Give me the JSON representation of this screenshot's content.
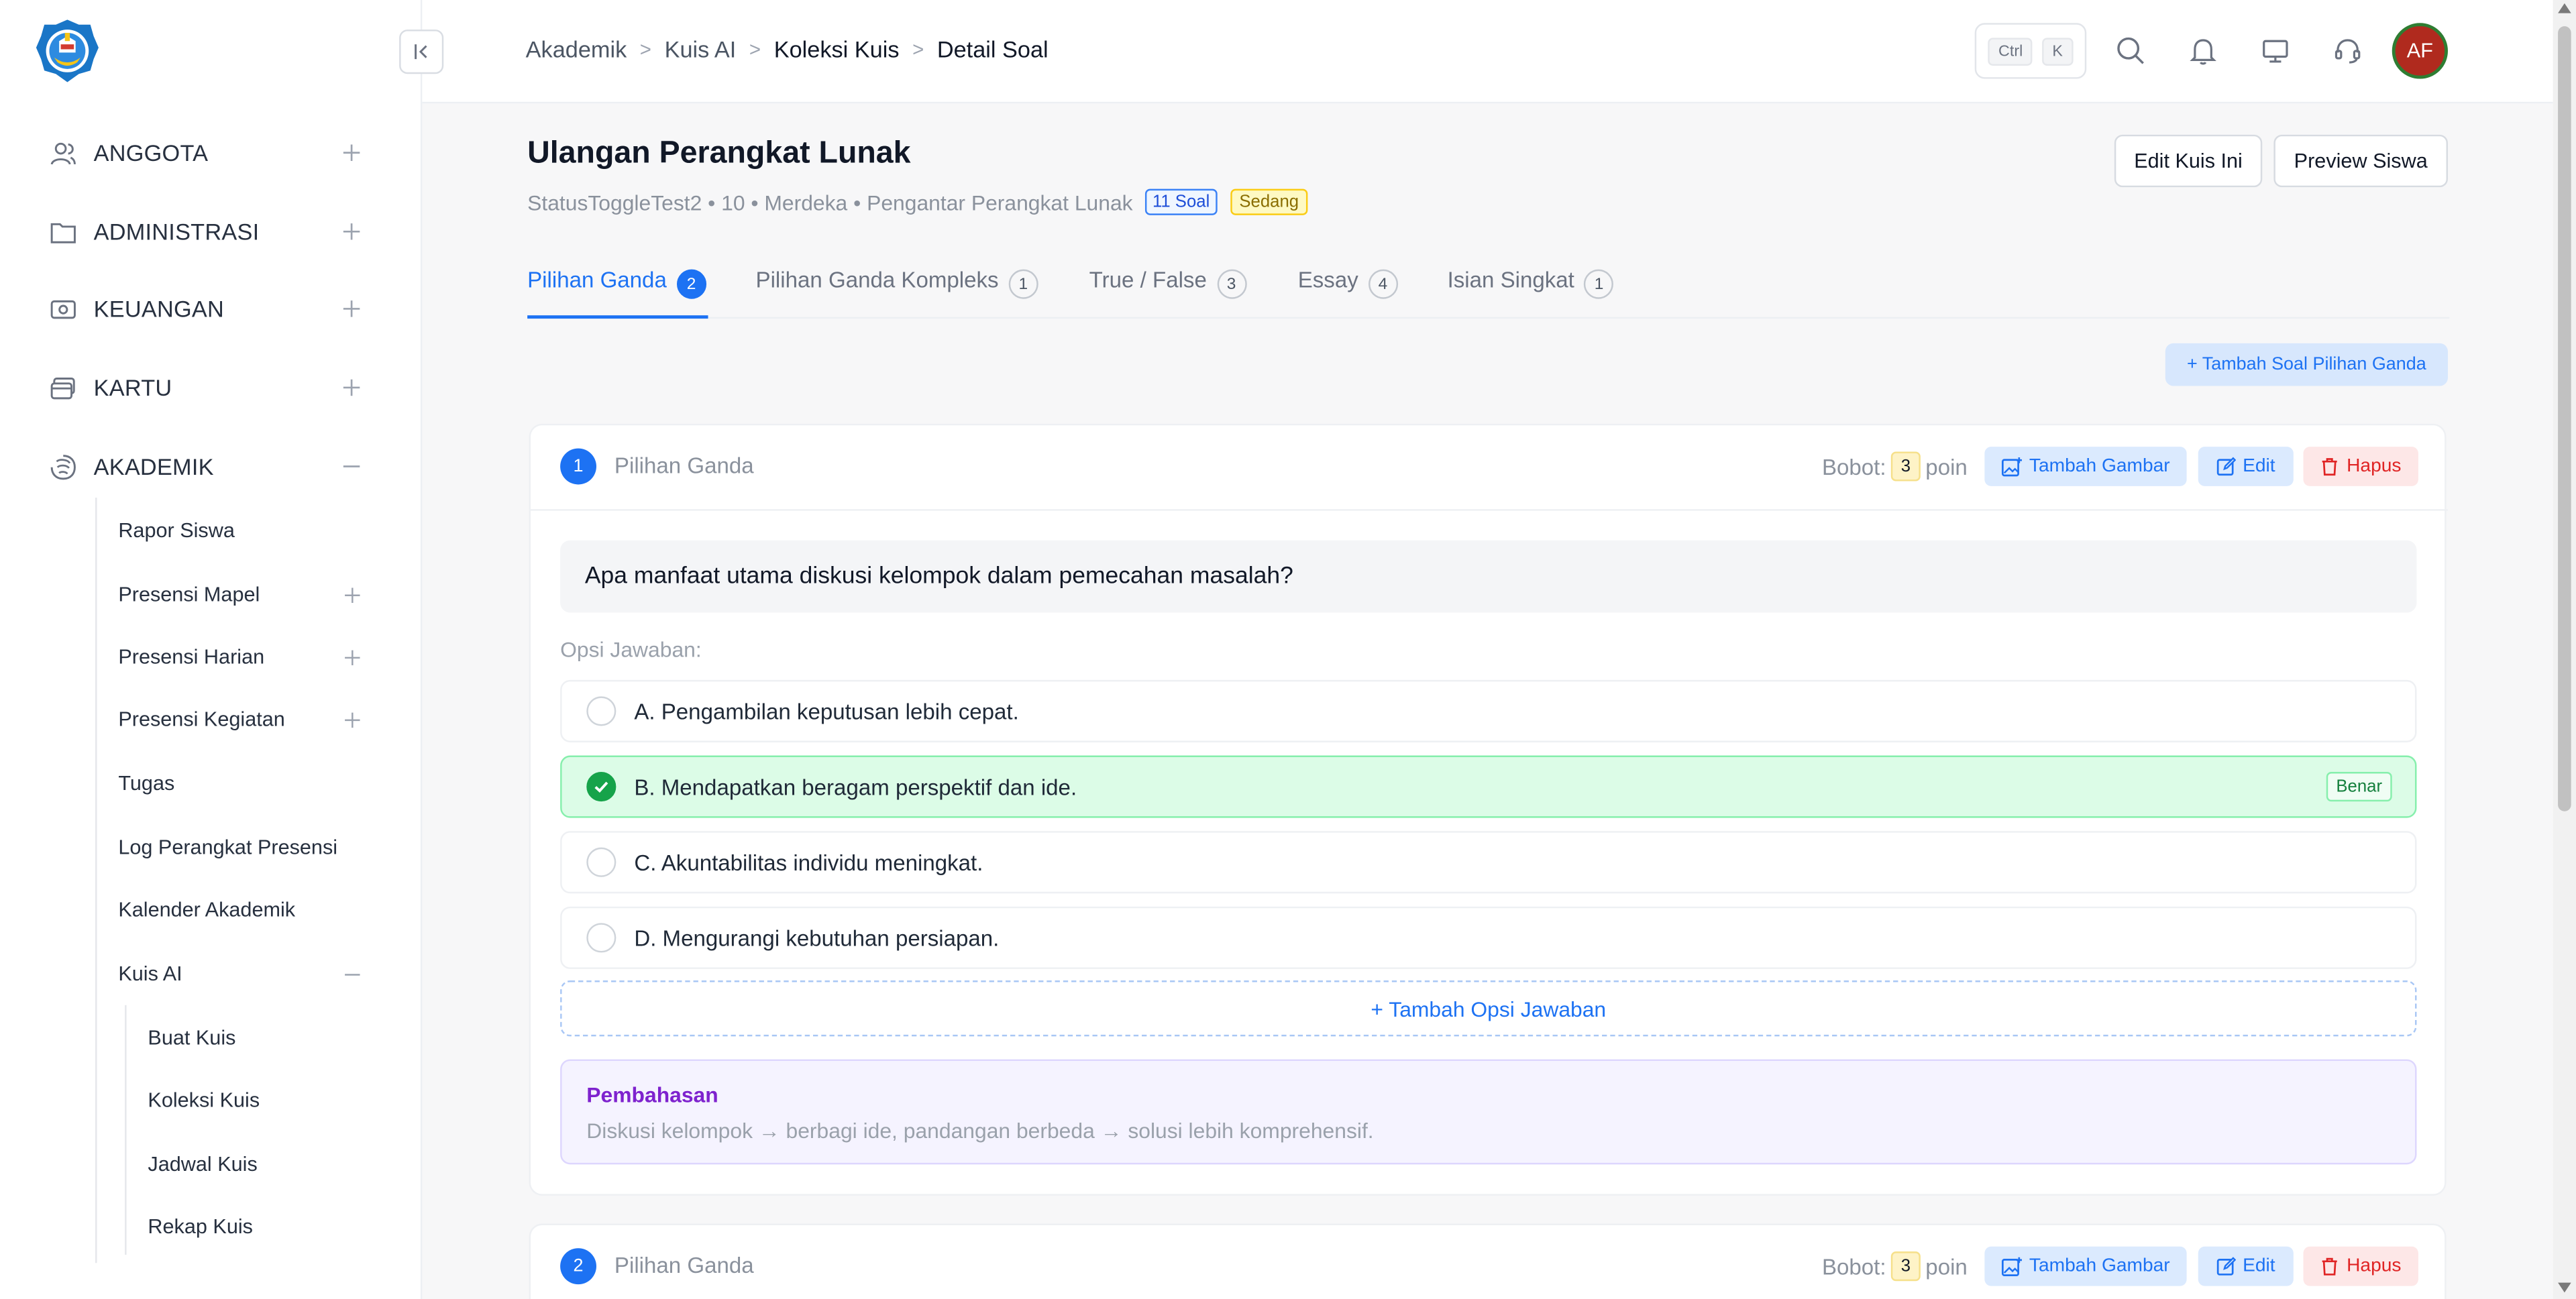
{
  "sidebar": {
    "items": [
      {
        "label": "ANGGOTA",
        "icon": "users-icon",
        "toggle": "+"
      },
      {
        "label": "ADMINISTRASI",
        "icon": "folder-icon",
        "toggle": "+"
      },
      {
        "label": "KEUANGAN",
        "icon": "money-icon",
        "toggle": "+"
      },
      {
        "label": "KARTU",
        "icon": "card-icon",
        "toggle": "+"
      },
      {
        "label": "AKADEMIK",
        "icon": "academic-icon",
        "toggle": "−"
      }
    ],
    "akademik_sub": [
      {
        "label": "Rapor Siswa"
      },
      {
        "label": "Presensi Mapel",
        "toggle": "+"
      },
      {
        "label": "Presensi Harian",
        "toggle": "+"
      },
      {
        "label": "Presensi Kegiatan",
        "toggle": "+"
      },
      {
        "label": "Tugas"
      },
      {
        "label": "Log Perangkat Presensi"
      },
      {
        "label": "Kalender Akademik"
      },
      {
        "label": "Kuis AI",
        "toggle": "−"
      }
    ],
    "kuis_sub": [
      {
        "label": "Buat Kuis"
      },
      {
        "label": "Koleksi Kuis"
      },
      {
        "label": "Jadwal Kuis"
      },
      {
        "label": "Rekap Kuis"
      }
    ]
  },
  "header": {
    "breadcrumb": [
      "Akademik",
      "Kuis AI",
      "Koleksi Kuis",
      "Detail Soal"
    ],
    "shortcut_keys": [
      "Ctrl",
      "K"
    ],
    "avatar_initials": "AF"
  },
  "quiz": {
    "title": "Ulangan Perangkat Lunak",
    "meta": "StatusToggleTest2 • 10 • Merdeka • Pengantar Perangkat Lunak",
    "soal_badge": "11 Soal",
    "level_badge": "Sedang",
    "edit_button": "Edit Kuis Ini",
    "preview_button": "Preview Siswa"
  },
  "tabs": [
    {
      "label": "Pilihan Ganda",
      "count": "2"
    },
    {
      "label": "Pilihan Ganda Kompleks",
      "count": "1"
    },
    {
      "label": "True / False",
      "count": "3"
    },
    {
      "label": "Essay",
      "count": "4"
    },
    {
      "label": "Isian Singkat",
      "count": "1"
    }
  ],
  "add_question_button": "+ Tambah Soal Pilihan Ganda",
  "labels": {
    "bobot": "Bobot:",
    "poin": "poin",
    "add_image": "Tambah Gambar",
    "edit": "Edit",
    "delete": "Hapus",
    "opsi": "Opsi Jawaban:",
    "correct": "Benar",
    "add_option": "+ Tambah Opsi Jawaban",
    "pembahasan": "Pembahasan"
  },
  "questions": [
    {
      "number": "1",
      "type": "Pilihan Ganda",
      "bobot": "3",
      "text": "Apa manfaat utama diskusi kelompok dalam pemecahan masalah?",
      "options": [
        {
          "text": "A. Pengambilan keputusan lebih cepat.",
          "correct": false
        },
        {
          "text": "B. Mendapatkan beragam perspektif dan ide.",
          "correct": true
        },
        {
          "text": "C. Akuntabilitas individu meningkat.",
          "correct": false
        },
        {
          "text": "D. Mengurangi kebutuhan persiapan.",
          "correct": false
        }
      ],
      "explanation": "Diskusi kelompok → berbagi ide, pandangan berbeda → solusi lebih komprehensif."
    },
    {
      "number": "2",
      "type": "Pilihan Ganda",
      "bobot": "3"
    }
  ],
  "colors": {
    "accent": "#1d72f3",
    "correct_bg": "#dcfce7",
    "danger": "#e02424",
    "explanation_title": "#7e22ce"
  }
}
